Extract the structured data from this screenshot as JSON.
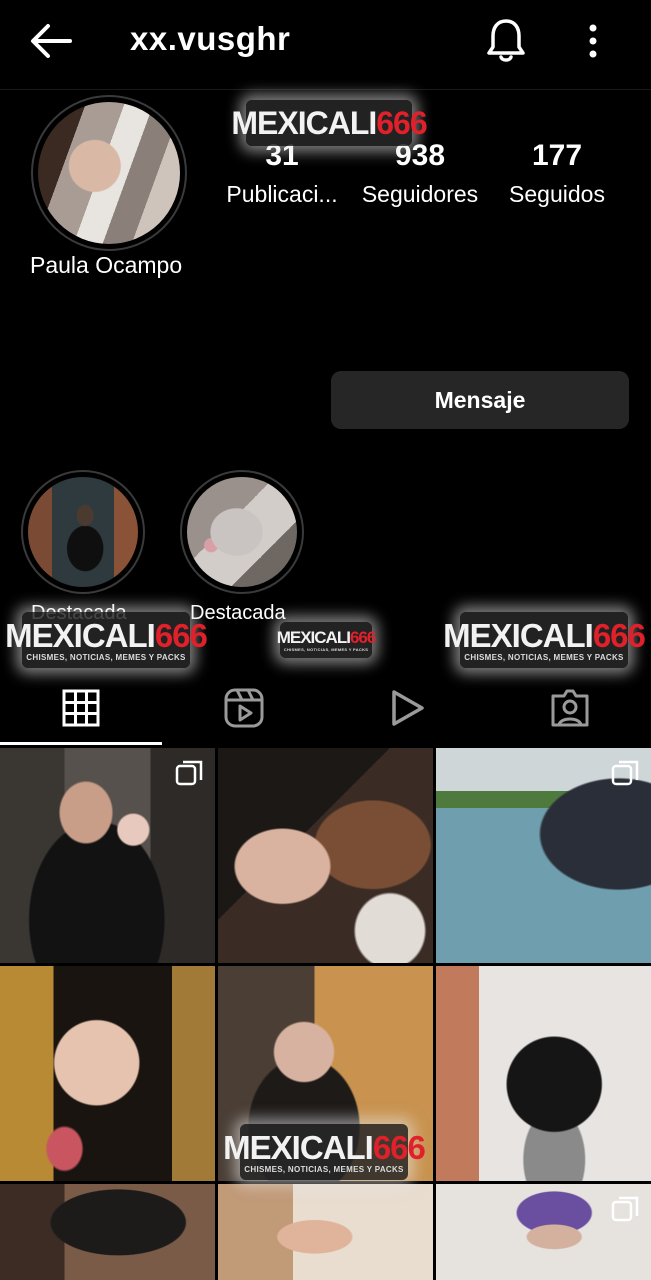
{
  "header": {
    "username": "xx.vusghr",
    "back_icon": "arrow-left-icon",
    "bell_icon": "bell-icon",
    "more_icon": "more-vertical-icon"
  },
  "profile": {
    "display_name": "Paula Ocampo",
    "stats": [
      {
        "value": "31",
        "label": "Publicaci..."
      },
      {
        "value": "938",
        "label": "Seguidores"
      },
      {
        "value": "177",
        "label": "Seguidos"
      }
    ],
    "message_button": "Mensaje"
  },
  "highlights": [
    {
      "label": "Destacada"
    },
    {
      "label": "Destacada"
    }
  ],
  "watermark": {
    "brand_main": "MEXICALI",
    "brand_num": "666",
    "tagline": "CHISMES, NOTICIAS, MEMES Y PACKS"
  },
  "tabs": [
    {
      "icon": "grid-icon",
      "active": true
    },
    {
      "icon": "reels-icon",
      "active": false
    },
    {
      "icon": "play-icon",
      "active": false
    },
    {
      "icon": "tagged-user-icon",
      "active": false
    }
  ],
  "colors": {
    "background": "#000000",
    "button_bg": "#262626",
    "accent_red": "#e0202a"
  }
}
